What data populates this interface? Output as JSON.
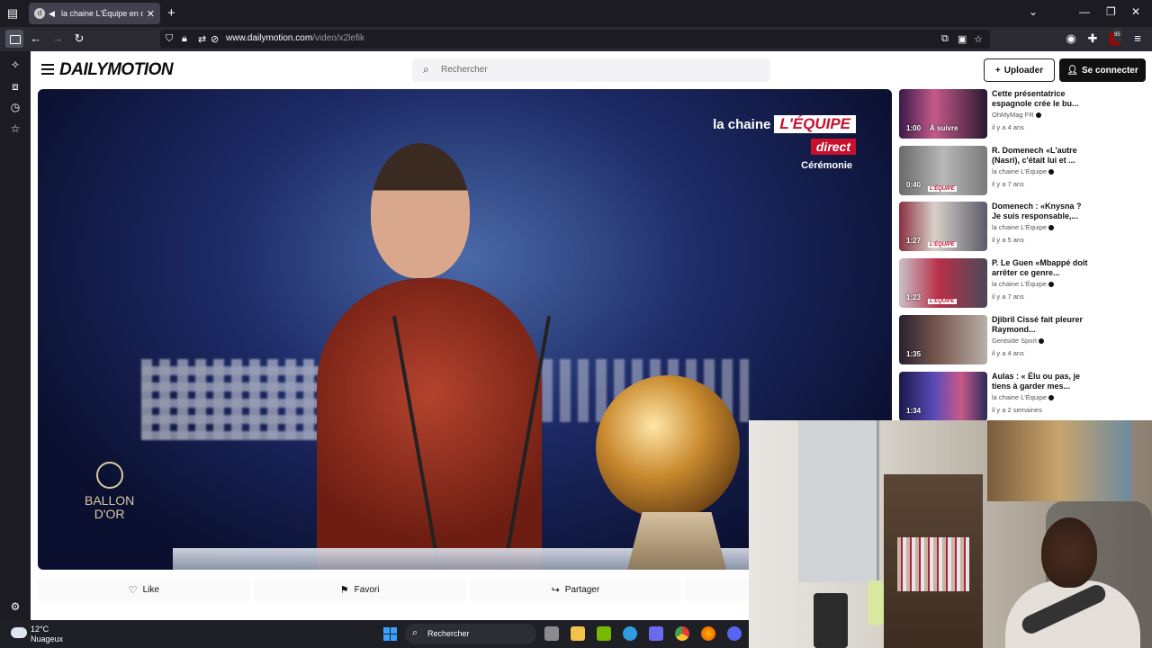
{
  "browser": {
    "tab_title": "la chaine L'Équipe en direct",
    "url_host": "www.dailymotion.com",
    "url_path": "/video/x2lefik",
    "notification_badge": "95"
  },
  "site": {
    "logo": "DAILYMOTION",
    "search_placeholder": "Rechercher",
    "upload_label": "Uploader",
    "login_label": "Se connecter"
  },
  "player": {
    "overlay_channel": "la chaine",
    "overlay_brand": "L'ÉQUIPE",
    "overlay_direct": "direct",
    "overlay_program": "Cérémonie",
    "ballon_line1": "BALLON",
    "ballon_line2": "D'OR"
  },
  "actions": {
    "like": "Like",
    "favori": "Favori",
    "partager": "Partager"
  },
  "recommendations": [
    {
      "title": "Cette présentatrice espagnole crée le bu...",
      "channel": "OhMyMag FR",
      "ago": "il y a 4 ans",
      "duration": "1:00",
      "badge": "À suivre"
    },
    {
      "title": "R. Domenech «L'autre (Nasri), c'était lui et ...",
      "channel": "la chaine L'Équipe",
      "ago": "il y a 7 ans",
      "duration": "0:40"
    },
    {
      "title": "Domenech : «Knysna ? Je suis responsable,...",
      "channel": "la chaine L'Équipe",
      "ago": "il y a 5 ans",
      "duration": "1:27"
    },
    {
      "title": "P. Le Guen «Mbappé doit arrêter ce genre...",
      "channel": "la chaine L'Équipe",
      "ago": "il y a 7 ans",
      "duration": "1:23"
    },
    {
      "title": "Djibril Cissé fait pleurer Raymond...",
      "channel": "Gentside Sport",
      "ago": "il y a 4 ans",
      "duration": "1:35"
    },
    {
      "title": "Aulas : « Élu ou pas, je tiens à garder mes...",
      "channel": "la chaine L'Équipe",
      "ago": "il y a 2 semaines",
      "duration": "1:34"
    }
  ],
  "taskbar": {
    "temperature": "12°C",
    "weather": "Nuageux",
    "search_placeholder": "Rechercher"
  }
}
